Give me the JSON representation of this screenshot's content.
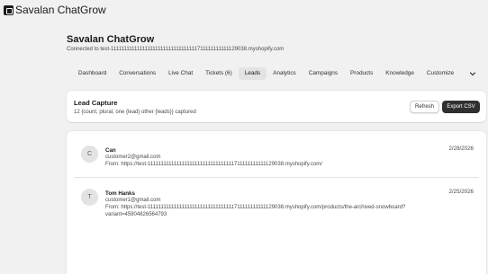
{
  "app": {
    "name": "Savalan ChatGrow"
  },
  "page": {
    "title": "Savalan ChatGrow",
    "subtitle": "Connected to test-111111111111111111111111111111111711111111111129038.myshopify.com"
  },
  "tabs": [
    {
      "label": "Dashboard",
      "active": false
    },
    {
      "label": "Conversations",
      "active": false
    },
    {
      "label": "Live Chat",
      "active": false
    },
    {
      "label": "Tickets (6)",
      "active": false
    },
    {
      "label": "Leads",
      "active": true
    },
    {
      "label": "Analytics",
      "active": false
    },
    {
      "label": "Campaigns",
      "active": false
    },
    {
      "label": "Products",
      "active": false
    },
    {
      "label": "Knowledge",
      "active": false
    },
    {
      "label": "Customize",
      "active": false
    }
  ],
  "tabs_more_icon": "chevron-down-icon",
  "capture": {
    "title": "Lead Capture",
    "subtitle": "12 {count, plural, one {lead} other {leads}} captured",
    "refresh_label": "Refresh",
    "export_label": "Export CSV"
  },
  "leads": [
    {
      "initial": "C",
      "name": "Can",
      "email": "customer2@gmail.com",
      "from": "From: https://test-111111111111111111111111111111111711111111111129038.myshopify.com/",
      "date": "2/28/2026"
    },
    {
      "initial": "T",
      "name": "Tom Hanks",
      "email": "customer1@gmail.com",
      "from": "From: https://test-111111111111111111111111111111111711111111111129038.myshopify.com/products/the-archived-snowboard?variant=45904826564793",
      "date": "2/25/2026"
    }
  ]
}
